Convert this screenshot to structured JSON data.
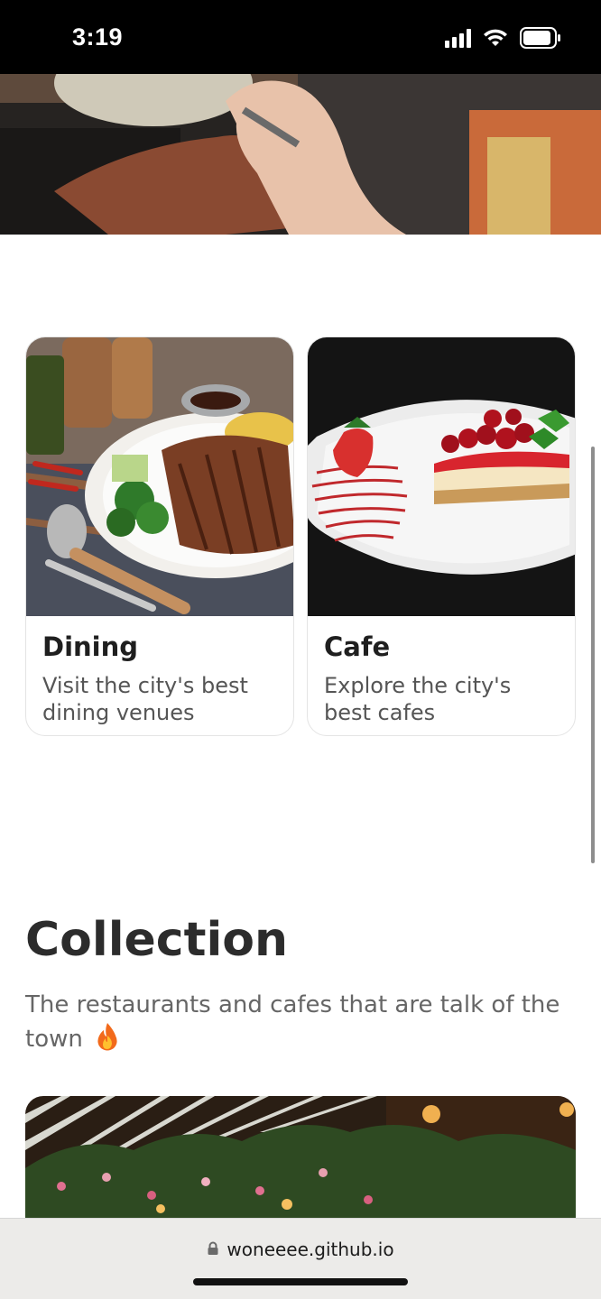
{
  "status_bar": {
    "time": "3:19",
    "icons": [
      "signal-icon",
      "wifi-icon",
      "battery-icon"
    ]
  },
  "categories": [
    {
      "title": "Dining",
      "description": "Visit the city's best dining venues",
      "image": "grilled-steak-plate-photo"
    },
    {
      "title": "Cafe",
      "description": "Explore the city's best cafes",
      "image": "strawberry-cheesecake-photo"
    }
  ],
  "collection": {
    "title": "Collection",
    "subtitle": "The restaurants and cafes that are talk of the town",
    "subtitle_icon": "flame-icon",
    "image": "restaurant-terrace-flowers-photo"
  },
  "browser": {
    "url": "woneeee.github.io",
    "lock_icon": "lock-icon"
  },
  "colors": {
    "text_primary": "#1f1f1f",
    "text_secondary": "#555555",
    "card_border": "#e4e4e4",
    "browser_bar": "#ecebe9"
  }
}
